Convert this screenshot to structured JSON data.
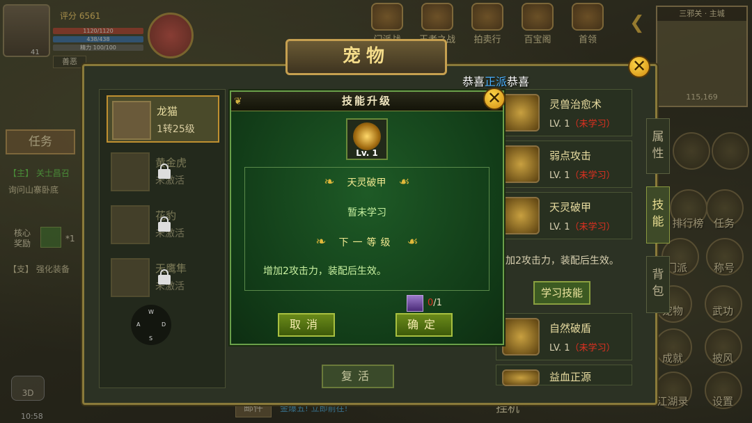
{
  "player": {
    "power": "评分 6561",
    "level": "41",
    "hp": "1120/1120",
    "mp": "438/438",
    "energy": "精力 100/100",
    "pk_mode": "善恶"
  },
  "top_menu": [
    {
      "label": "门派战",
      "icon": "sect-war-icon"
    },
    {
      "label": "王者之战",
      "icon": "king-battle-icon"
    },
    {
      "label": "拍卖行",
      "icon": "auction-icon"
    },
    {
      "label": "百宝阁",
      "icon": "treasure-icon"
    },
    {
      "label": "首领",
      "icon": "boss-icon"
    }
  ],
  "minimap": {
    "title": "三邪关 · 主城",
    "coords": "115,169"
  },
  "quest": {
    "tab_label": "任务",
    "main_quest": "【主】 关士昌召",
    "main_detail": "询问山寨卧底",
    "reward_label": "核心奖励",
    "reward_count": "*1",
    "branch_quest": "【支】 强化装备"
  },
  "side_menu": [
    {
      "label": "排行榜"
    },
    {
      "label": "任务"
    },
    {
      "label": "门派"
    },
    {
      "label": "称号"
    },
    {
      "label": "宠物"
    },
    {
      "label": "武功"
    },
    {
      "label": "成就"
    },
    {
      "label": "披风"
    },
    {
      "label": "江湖录"
    },
    {
      "label": "设置"
    }
  ],
  "bottom": {
    "time": "10:58",
    "mail": "邮件",
    "chat": "金爆五! 立即前往!",
    "idle": "挂机",
    "view_mode": "3D"
  },
  "pet_window": {
    "title": "宠物",
    "congrats_prefix": "恭喜",
    "congrats_faction": "正派",
    "congrats_suffix": "恭喜",
    "pets": [
      {
        "name": "龙猫",
        "sub": "1转25级",
        "locked": false
      },
      {
        "name": "黄金虎",
        "sub": "未激活",
        "locked": true
      },
      {
        "name": "花豹",
        "sub": "未激活",
        "locked": true
      },
      {
        "name": "天鹰隼",
        "sub": "未激活",
        "locked": true
      }
    ],
    "joystick": {
      "w": "W",
      "a": "A",
      "s": "S",
      "d": "D"
    },
    "revive": "复活",
    "skills": [
      {
        "name": "灵兽治愈术",
        "lv": "LV. 1",
        "status": "（未学习）"
      },
      {
        "name": "弱点攻击",
        "lv": "LV. 1",
        "status": "（未学习）"
      },
      {
        "name": "天灵破甲",
        "lv": "LV. 1",
        "status": "（未学习）"
      },
      {
        "name": "自然破盾",
        "lv": "LV. 1",
        "status": "（未学习）"
      },
      {
        "name": "益血正源",
        "lv": "",
        "status": ""
      }
    ],
    "skill_desc": "增加2攻击力，装配后生效。",
    "learn_btn": "学习技能",
    "tabs": [
      "属性",
      "技能",
      "背包"
    ]
  },
  "dialog": {
    "title": "技能升级",
    "skill_level": "Lv. 1",
    "skill_name": "天灵破甲",
    "status": "暂未学习",
    "next_label": "下一等级",
    "effect": "增加2攻击力，装配后生效。",
    "material_have": "0",
    "material_need": "/1",
    "cancel": "取消",
    "confirm": "确定"
  }
}
